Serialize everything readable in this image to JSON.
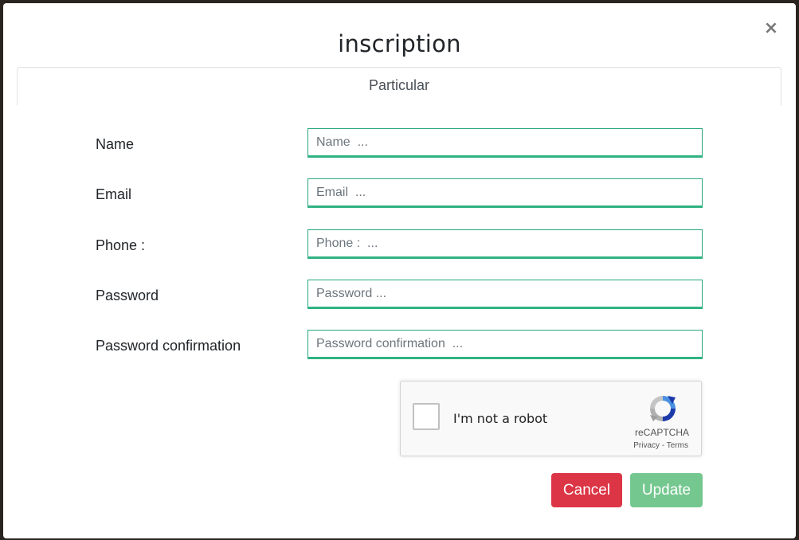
{
  "modal": {
    "title": "inscription",
    "close_symbol": "×",
    "tab_label": "Particular"
  },
  "form": {
    "fields": [
      {
        "label": "Name",
        "placeholder": "Name  ..."
      },
      {
        "label": "Email",
        "placeholder": "Email  ..."
      },
      {
        "label": "Phone :",
        "placeholder": "Phone :  ..."
      },
      {
        "label": "Password",
        "placeholder": "Password ..."
      },
      {
        "label": "Password confirmation",
        "placeholder": "Password confirmation  ..."
      }
    ]
  },
  "recaptcha": {
    "label": "I'm not a robot",
    "brand": "reCAPTCHA",
    "privacy": "Privacy",
    "separator": "-",
    "terms": "Terms",
    "icon": "recaptcha-logo-icon"
  },
  "buttons": {
    "cancel": "Cancel",
    "update": "Update"
  },
  "colors": {
    "cancel": "#dc3545",
    "update": "#74c78f",
    "input_border": "#26a67a"
  }
}
